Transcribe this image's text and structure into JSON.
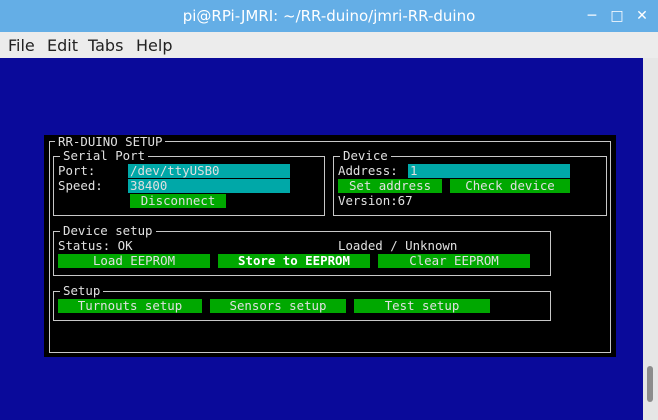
{
  "window": {
    "title": "pi@RPi-JMRI: ~/RR-duino/jmri-RR-duino",
    "minimize": "─",
    "maximize": "□",
    "close": "✕"
  },
  "menu": {
    "file": "File",
    "edit": "Edit",
    "tabs": "Tabs",
    "help": "Help"
  },
  "setup": {
    "title": "RR-DUINO SETUP",
    "serial": {
      "title": "Serial Port",
      "port_label": "Port:",
      "port_value": "/dev/ttyUSB0",
      "speed_label": "Speed:",
      "speed_value": "38400",
      "disconnect": "Disconnect"
    },
    "device": {
      "title": "Device",
      "address_label": "Address:",
      "address_value": "1",
      "set_address": "Set address",
      "check_device": "Check device",
      "version": "Version:67"
    },
    "device_setup": {
      "title": "Device setup",
      "status": "Status: OK",
      "loaded": "Loaded / Unknown",
      "load": "Load EEPROM",
      "store": "Store to EEPROM",
      "clear": "Clear EEPROM"
    },
    "setup_box": {
      "title": "Setup",
      "turnouts": "Turnouts setup",
      "sensors": "Sensors setup",
      "test": "Test setup"
    }
  },
  "colors": {
    "terminal_bg": "#0a0a9a",
    "field": "#00a8a8",
    "button": "#00a800",
    "titlebar": "#64aee6"
  }
}
